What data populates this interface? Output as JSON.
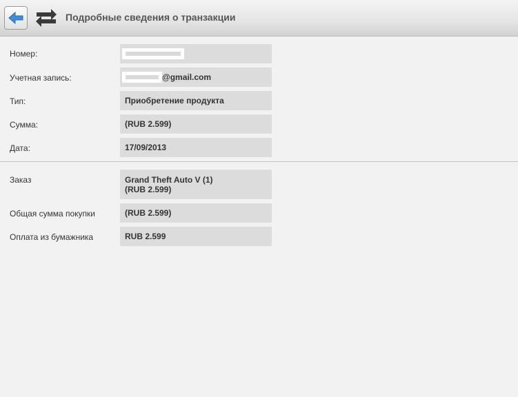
{
  "header": {
    "title": "Подробные сведения о транзакции",
    "back_icon": "arrow-left-icon",
    "transaction_icon": "swap-arrows-icon",
    "accent_color": "#3c8fd6"
  },
  "details": {
    "number_label": "Номер:",
    "account_label": "Учетная запись:",
    "account_suffix": "@gmail.com",
    "type_label": "Тип:",
    "type_value": "Приобретение продукта",
    "amount_label": "Сумма:",
    "amount_value": "(RUB 2.599)",
    "date_label": "Дата:",
    "date_value": "17/09/2013"
  },
  "order": {
    "order_label": "Заказ",
    "order_item": "Grand Theft Auto V (1)",
    "order_price": "(RUB 2.599)",
    "total_label": "Общая сумма покупки",
    "total_value": "(RUB 2.599)",
    "wallet_label": "Оплата из бумажника",
    "wallet_value": "RUB 2.599"
  }
}
